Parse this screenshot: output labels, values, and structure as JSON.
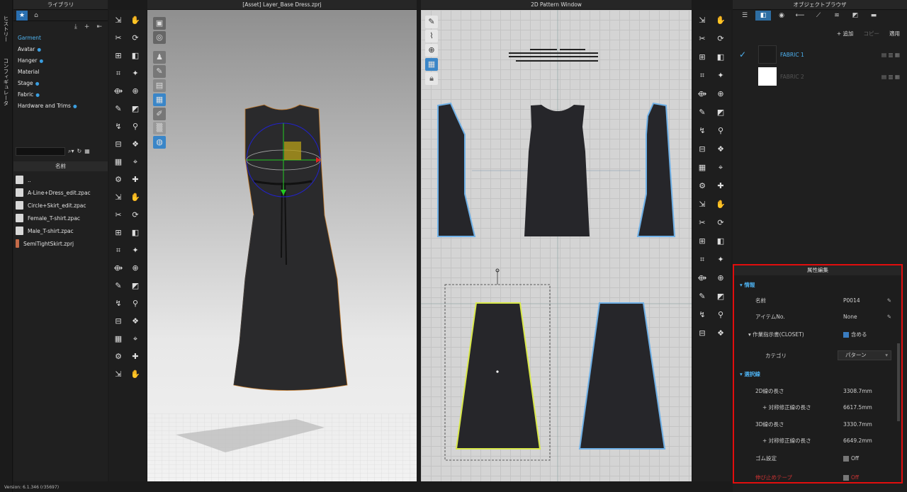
{
  "sidebar_tabs": [
    "ヒストリー",
    "コンフィギュレータ"
  ],
  "library": {
    "title": "ライブラリ",
    "categories": [
      {
        "label": "Garment",
        "selected": true,
        "dot": false
      },
      {
        "label": "Avatar",
        "selected": false,
        "dot": true
      },
      {
        "label": "Hanger",
        "selected": false,
        "dot": true
      },
      {
        "label": "Material",
        "selected": false,
        "dot": false
      },
      {
        "label": "Stage",
        "selected": false,
        "dot": true
      },
      {
        "label": "Fabric",
        "selected": false,
        "dot": true
      },
      {
        "label": "Hardware and Trims",
        "selected": false,
        "dot": true
      }
    ],
    "name_header": "名前",
    "files": [
      "..",
      "A-Line+Dress_edit.zpac",
      "Circle+Skirt_edit.zpac",
      "Female_T-shirt.zpac",
      "Male_T-shirt.zpac",
      "SemiTightSkirt.zprj"
    ]
  },
  "viewport3d": {
    "title": "[Asset] Layer_Base Dress.zprj"
  },
  "viewport2d": {
    "title": "2D Pattern Window"
  },
  "object_browser": {
    "title": "オブジェクトブラウザ",
    "actions": {
      "add": "+ 追加",
      "copy": "コピー",
      "apply": "適用"
    },
    "fabrics": [
      {
        "name": "FABRIC 1",
        "active": true,
        "swatch": "#1c1c1c"
      },
      {
        "name": "FABRIC 2",
        "active": false,
        "swatch": "#ffffff"
      }
    ]
  },
  "property_editor": {
    "title": "属性編集",
    "info_section": "情報",
    "name_label": "名前",
    "name_value": "P0014",
    "item_label": "アイテムNo.",
    "item_value": "None",
    "instruction_label": "作業指示書(CLOSET)",
    "instruction_value": "含める",
    "category_label": "カテゴリ",
    "category_value": "パターン",
    "selected_line_section": "選択線",
    "len2d_label": "2D線の長さ",
    "len2d_value": "3308.7mm",
    "sym2d_label": "+ 対称修正線の長さ",
    "sym2d_value": "6617.5mm",
    "len3d_label": "3D線の長さ",
    "len3d_value": "3330.7mm",
    "sym3d_label": "+ 対称修正線の長さ",
    "sym3d_value": "6649.2mm",
    "elastic_label": "ゴム設定",
    "elastic_value": "Off",
    "tape_label": "伸び止めテープ",
    "tape_value": "Off"
  },
  "version": "Version: 6.1.346 (r35697)"
}
